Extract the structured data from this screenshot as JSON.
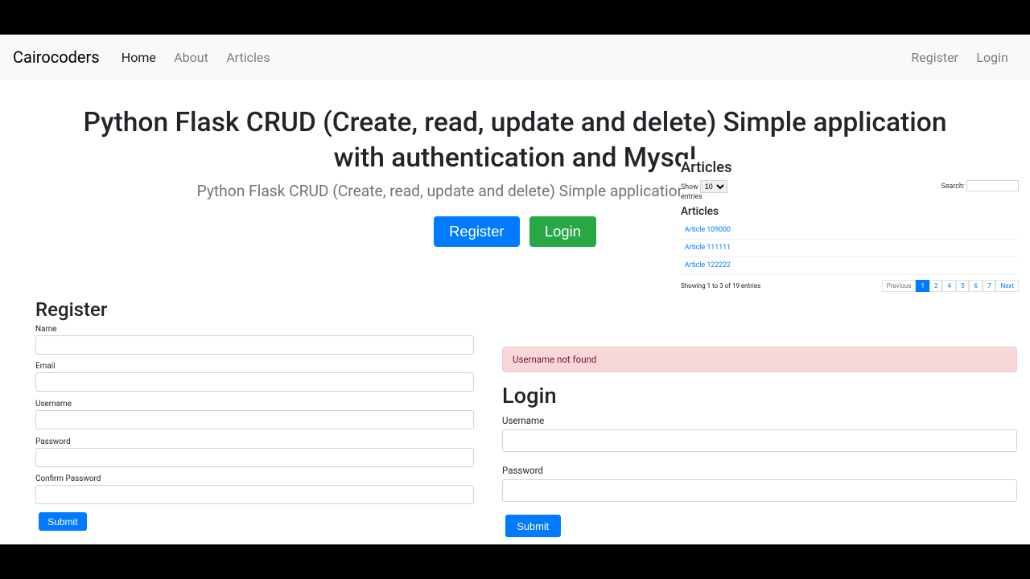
{
  "navbar": {
    "brand": "Cairocoders",
    "left": [
      {
        "label": "Home",
        "active": true
      },
      {
        "label": "About",
        "active": false
      },
      {
        "label": "Articles",
        "active": false
      }
    ],
    "right": [
      {
        "label": "Register"
      },
      {
        "label": "Login"
      }
    ]
  },
  "hero": {
    "title": "Python Flask CRUD (Create, read, update and delete) Simple application with authentication and Mysql",
    "lead": "Python Flask CRUD (Create, read, update and delete) Simple application with authentication a",
    "register_btn": "Register",
    "login_btn": "Login"
  },
  "register": {
    "heading": "Register",
    "fields": {
      "name": "Name",
      "email": "Email",
      "username": "Username",
      "password": "Password",
      "confirm": "Confirm Password"
    },
    "submit": "Submit"
  },
  "login": {
    "alert": "Username not found",
    "heading": "Login",
    "username_label": "Username",
    "password_label": "Password",
    "submit": "Submit"
  },
  "articles": {
    "heading": "Articles",
    "show_label": "Show",
    "show_value": "10",
    "entries_label": "entries",
    "search_label": "Search:",
    "sub_heading": "Articles",
    "items": [
      "Article 109000",
      "Article 111111",
      "Article 122222"
    ],
    "info": "Showing 1 to 3 of 19 entries",
    "pager": [
      "Previous",
      "1",
      "2",
      "4",
      "5",
      "6",
      "7",
      "Next"
    ]
  }
}
